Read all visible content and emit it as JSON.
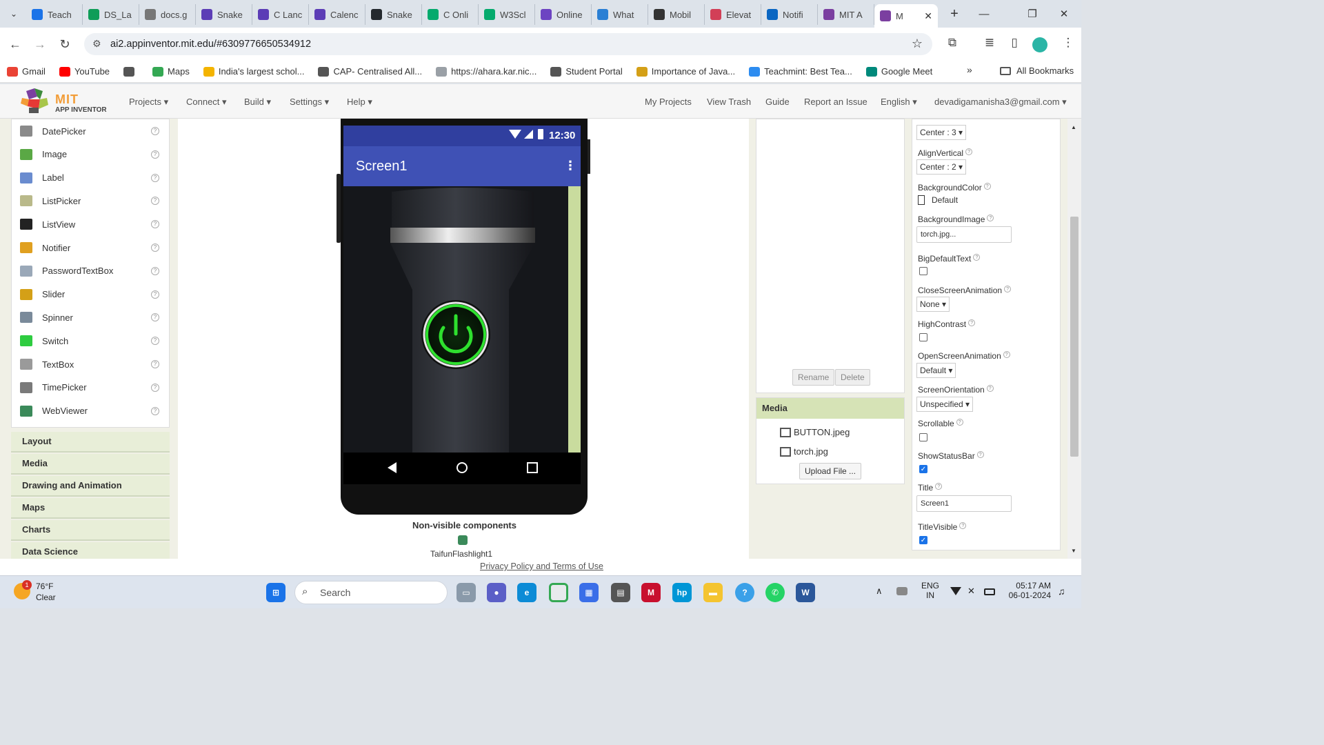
{
  "browser": {
    "tabs": [
      {
        "label": "Teach",
        "color": "#1a73e8"
      },
      {
        "label": "DS_La",
        "color": "#0f9d58"
      },
      {
        "label": "docs.g",
        "color": "#777777"
      },
      {
        "label": "Snake",
        "color": "#5c3db6"
      },
      {
        "label": "C Lanc",
        "color": "#5c3db6"
      },
      {
        "label": "Calenc",
        "color": "#5c3db6"
      },
      {
        "label": "Snake",
        "color": "#24292e"
      },
      {
        "label": "C Onli",
        "color": "#04aa6d"
      },
      {
        "label": "W3Scl",
        "color": "#04aa6d"
      },
      {
        "label": "Online",
        "color": "#6d44c2"
      },
      {
        "label": "What",
        "color": "#2a7fd4"
      },
      {
        "label": "Mobil",
        "color": "#333333"
      },
      {
        "label": "Elevat",
        "color": "#d23f57"
      },
      {
        "label": "Notifi",
        "color": "#0a66c2"
      },
      {
        "label": "MIT A",
        "color": "#7b3fa0"
      }
    ],
    "active_tab": {
      "label": "M",
      "color": "#7b3fa0"
    },
    "url": "ai2.appinventor.mit.edu/#6309776650534912",
    "bookmarks": [
      {
        "label": "Gmail",
        "color": "#ea4335"
      },
      {
        "label": "YouTube",
        "color": "#ff0000"
      },
      {
        "label": "",
        "color": "#555555"
      },
      {
        "label": "Maps",
        "color": "#34a853"
      },
      {
        "label": "India's largest schol...",
        "color": "#f4b400"
      },
      {
        "label": "CAP- Centralised All...",
        "color": "#555555"
      },
      {
        "label": "https://ahara.kar.nic...",
        "color": "#9aa0a6"
      },
      {
        "label": "Student Portal",
        "color": "#555555"
      },
      {
        "label": "Importance of Java...",
        "color": "#d4a017"
      },
      {
        "label": "Teachmint: Best Tea...",
        "color": "#2d8cf0"
      },
      {
        "label": "Google Meet",
        "color": "#00897b"
      }
    ],
    "all_bookmarks": "All Bookmarks"
  },
  "app": {
    "logo_title": "MIT",
    "logo_subtitle": "APP INVENTOR",
    "menu_left": [
      "Projects ▾",
      "Connect ▾",
      "Build ▾",
      "Settings ▾",
      "Help ▾"
    ],
    "menu_right": [
      "My Projects",
      "View Trash",
      "Guide",
      "Report an Issue",
      "English ▾",
      "devadigamanisha3@gmail.com ▾"
    ]
  },
  "palette": {
    "items": [
      {
        "label": "DatePicker",
        "color": "#8a8a8a"
      },
      {
        "label": "Image",
        "color": "#5aa845"
      },
      {
        "label": "Label",
        "color": "#6a8ccf"
      },
      {
        "label": "ListPicker",
        "color": "#b9b98a"
      },
      {
        "label": "ListView",
        "color": "#222222"
      },
      {
        "label": "Notifier",
        "color": "#e0a020"
      },
      {
        "label": "PasswordTextBox",
        "color": "#9aa8b8"
      },
      {
        "label": "Slider",
        "color": "#d4a017"
      },
      {
        "label": "Spinner",
        "color": "#7a8a9a"
      },
      {
        "label": "Switch",
        "color": "#2ecc40"
      },
      {
        "label": "TextBox",
        "color": "#9a9a9a"
      },
      {
        "label": "TimePicker",
        "color": "#7a7a7a"
      },
      {
        "label": "WebViewer",
        "color": "#3b8a5a"
      }
    ],
    "help_glyph": "?",
    "categories": [
      "Layout",
      "Media",
      "Drawing and Animation",
      "Maps",
      "Charts",
      "Data Science"
    ]
  },
  "phone": {
    "time": "12:30",
    "screen_title": "Screen1"
  },
  "nonvisible": {
    "title": "Non-visible components",
    "items": [
      "TaifunFlashlight1"
    ]
  },
  "components": {
    "rename": "Rename",
    "delete": "Delete"
  },
  "media": {
    "title": "Media",
    "files": [
      "BUTTON.jpeg",
      "torch.jpg"
    ],
    "upload": "Upload File ..."
  },
  "properties": {
    "align_horizontal": "Center : 3 ▾",
    "align_vertical_label": "AlignVertical",
    "align_vertical": "Center : 2 ▾",
    "background_color_label": "BackgroundColor",
    "background_color": "Default",
    "background_image_label": "BackgroundImage",
    "background_image": "torch.jpg...",
    "big_default_text_label": "BigDefaultText",
    "close_anim_label": "CloseScreenAnimation",
    "close_anim": "None ▾",
    "high_contrast_label": "HighContrast",
    "open_anim_label": "OpenScreenAnimation",
    "open_anim": "Default ▾",
    "orientation_label": "ScreenOrientation",
    "orientation": "Unspecified ▾",
    "scrollable_label": "Scrollable",
    "show_status_label": "ShowStatusBar",
    "title_label": "Title",
    "title": "Screen1",
    "title_visible_label": "TitleVisible",
    "help_glyph": "?"
  },
  "footer": {
    "link": "Privacy Policy and Terms of Use"
  },
  "taskbar": {
    "weather_temp": "76°F",
    "weather_desc": "Clear",
    "weather_badge": "1",
    "search": "Search",
    "lang": "ENG",
    "region": "IN",
    "time": "05:17 AM",
    "date": "06-01-2024"
  }
}
